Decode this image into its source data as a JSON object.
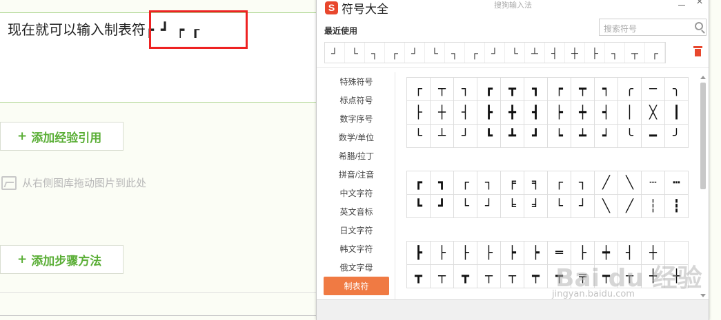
{
  "editor": {
    "text": "现在就可以输入制表符",
    "inserted": "┏┛┍┎",
    "add_reference": "添加经验引用",
    "drag_hint": "从右侧图库拖动图片到此处",
    "add_steps": "添加步骤方法",
    "plus": "+"
  },
  "symbol_window": {
    "logo": "S",
    "title": "符号大全",
    "ime_name": "搜狗输入法",
    "close": "×",
    "recent_label": "最近使用",
    "search_placeholder": "搜索符号",
    "recent": [
      "┘",
      "└",
      "┐",
      "┌",
      "┘",
      "└",
      "┐",
      "┌",
      "┘",
      "└",
      "┴",
      "┤",
      "┼",
      "├",
      "┐",
      "┬",
      "┌"
    ],
    "categories": [
      "特殊符号",
      "标点符号",
      "数字序号",
      "数学/单位",
      "希腊/拉丁",
      "拼音/注音",
      "中文字符",
      "英文音标",
      "日文字符",
      "韩文字符",
      "俄文字母",
      "制表符"
    ],
    "active_category": "制表符",
    "grid1": [
      "┌",
      "┬",
      "┐",
      "┏",
      "┳",
      "┓",
      "┍",
      "┯",
      "┑",
      "╭",
      "─",
      "╮",
      "├",
      "┼",
      "┤",
      "┣",
      "╋",
      "┫",
      "┝",
      "┿",
      "┥",
      "│",
      "╳",
      "┃",
      "└",
      "┴",
      "┘",
      "┗",
      "┻",
      "┛",
      "┕",
      "┷",
      "┙",
      "╰",
      "━",
      "╯"
    ],
    "grid2": [
      "┏",
      "┓",
      "┌",
      "┐",
      "╒",
      "╕",
      "┌",
      "┐",
      "╱",
      "╲",
      "┄",
      "┅",
      "┗",
      "┛",
      "└",
      "┘",
      "╘",
      "╛",
      "└",
      "┘",
      "╲",
      "╱",
      "┆",
      "┇"
    ],
    "grid3": [
      "┣",
      "├",
      "├",
      "├",
      "┝",
      "┝",
      "═",
      "├",
      "┿",
      "┤",
      "┼",
      "",
      "┳",
      "┬",
      "┳",
      "┬",
      "┬",
      "┯",
      "┯",
      "╤",
      "┯",
      "┬",
      "┼",
      "┼"
    ],
    "watermark": "Bai du 经验",
    "watermark_url": "jingyan.baidu.com"
  }
}
